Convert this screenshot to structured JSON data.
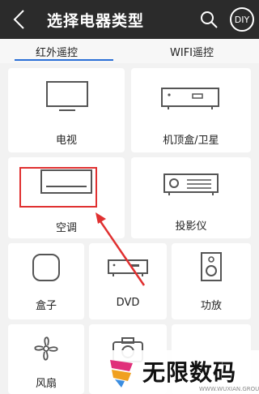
{
  "header": {
    "title": "选择电器类型",
    "diy_label": "DIY",
    "background": "#2b2b2b"
  },
  "tabs": [
    {
      "label": "红外遥控",
      "selected": true
    },
    {
      "label": "WIFI遥控",
      "selected": false
    }
  ],
  "devices": [
    {
      "label": "电视",
      "icon": "tv-icon"
    },
    {
      "label": "机顶盒/卫星",
      "icon": "set-top-box-icon"
    },
    {
      "label": "空调",
      "icon": "air-conditioner-icon"
    },
    {
      "label": "投影仪",
      "icon": "projector-icon"
    },
    {
      "label": "盒子",
      "icon": "media-box-icon"
    },
    {
      "label": "DVD",
      "icon": "dvd-icon"
    },
    {
      "label": "功放",
      "icon": "speaker-icon"
    },
    {
      "label": "风扇",
      "icon": "fan-icon"
    },
    {
      "label": "",
      "icon": "camera-icon"
    }
  ],
  "watermark": {
    "text": "无限数码",
    "sub": "WWW.WUXIAN.GROUP"
  },
  "colors": {
    "accent": "#2a6fd6",
    "highlight": "#e03030"
  }
}
